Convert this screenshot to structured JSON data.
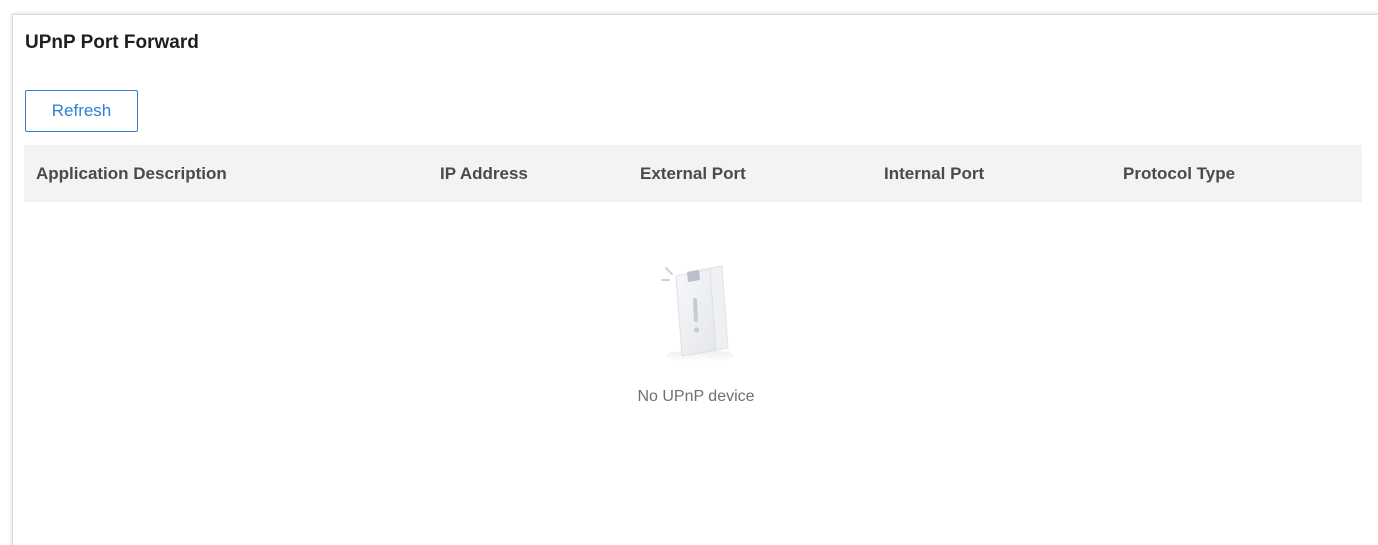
{
  "page": {
    "title": "UPnP Port Forward"
  },
  "toolbar": {
    "refresh_label": "Refresh"
  },
  "table": {
    "columns": [
      "Application Description",
      "IP Address",
      "External Port",
      "Internal Port",
      "Protocol Type"
    ],
    "rows": []
  },
  "empty_state": {
    "icon": "empty-document-warning-icon",
    "message": "No UPnP device"
  },
  "colors": {
    "accent": "#2f7fd6",
    "header_bg": "#f2f3f5",
    "text": "#1f1f1f",
    "muted": "#6f6f6f"
  }
}
